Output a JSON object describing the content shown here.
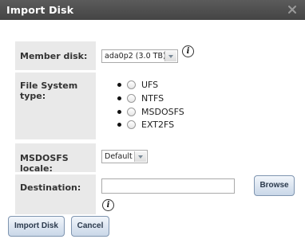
{
  "dialog": {
    "title": "Import Disk",
    "close_icon": "close-x-icon"
  },
  "form": {
    "member_disk": {
      "label": "Member disk:",
      "value": "ada0p2 (3.0 TB)"
    },
    "fs_type": {
      "label": "File System type:",
      "options": [
        "UFS",
        "NTFS",
        "MSDOSFS",
        "EXT2FS"
      ]
    },
    "locale": {
      "label": "MSDOSFS locale:",
      "value": "Default"
    },
    "destination": {
      "label": "Destination:",
      "value": "",
      "browse_label": "Browse"
    }
  },
  "info_glyph": "i",
  "buttons": {
    "import_label": "Import Disk",
    "cancel_label": "Cancel"
  },
  "colors": {
    "titlebar": "#4f4f4f",
    "label_bg": "#e9e9e9",
    "button_border": "#7f95b0"
  }
}
